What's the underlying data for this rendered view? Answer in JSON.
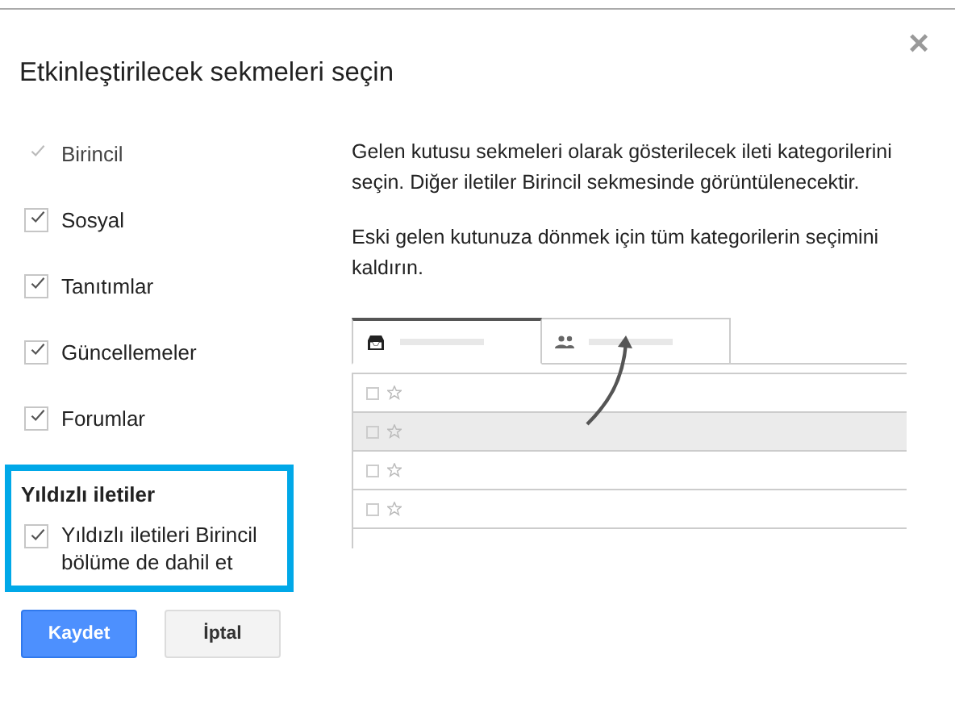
{
  "dialog": {
    "title": "Etkinleştirilecek sekmeleri seçin",
    "close": "×"
  },
  "categories": [
    {
      "label": "Birincil",
      "checked": true,
      "disabled": true
    },
    {
      "label": "Sosyal",
      "checked": true,
      "disabled": false
    },
    {
      "label": "Tanıtımlar",
      "checked": true,
      "disabled": false
    },
    {
      "label": "Güncellemeler",
      "checked": true,
      "disabled": false
    },
    {
      "label": "Forumlar",
      "checked": true,
      "disabled": false
    }
  ],
  "starred": {
    "heading": "Yıldızlı iletiler",
    "option": {
      "label": "Yıldızlı iletileri Birincil bölüme de dahil et",
      "checked": true
    }
  },
  "description": [
    "Gelen kutusu sekmeleri olarak gösterilecek ileti kategorilerini seçin. Diğer iletiler Birincil sekmesinde görüntülenecektir.",
    "Eski gelen kutunuza dönmek için tüm kategorilerin seçimini kaldırın."
  ],
  "buttons": [
    {
      "label": "Kaydet",
      "kind": "primary"
    },
    {
      "label": "İptal",
      "kind": "secondary"
    }
  ]
}
